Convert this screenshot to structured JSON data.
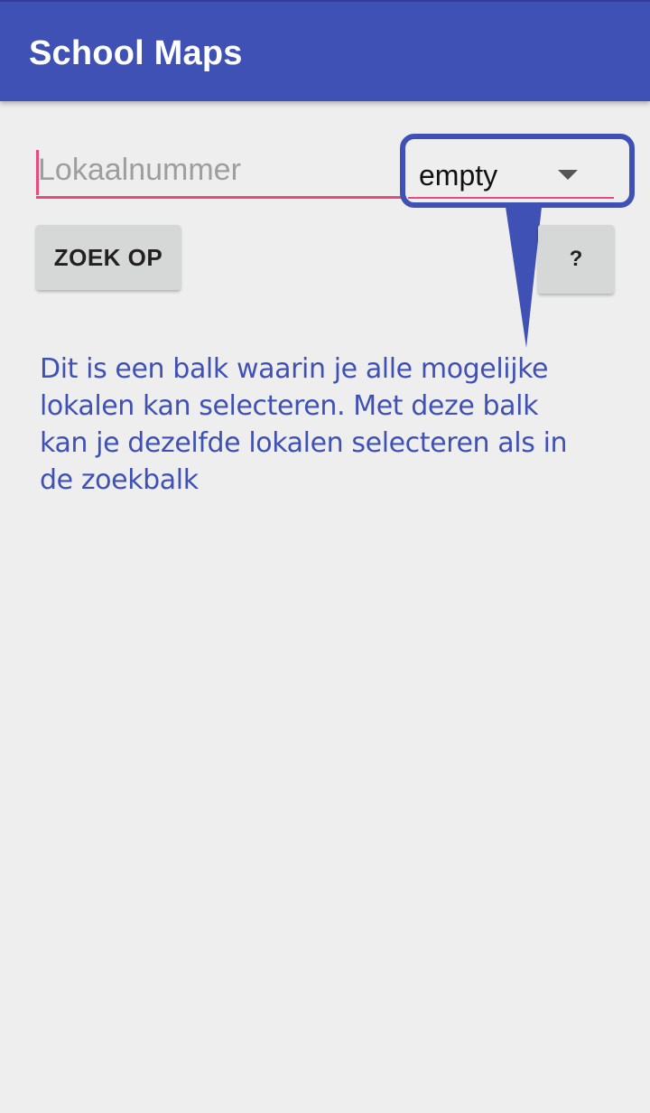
{
  "app_bar": {
    "title": "School Maps",
    "color": "#3f51b5"
  },
  "search": {
    "placeholder": "Lokaalnummer",
    "value": "",
    "accent_color": "#e84a80"
  },
  "spinner": {
    "selected": "empty",
    "icon": "dropdown-arrow-icon"
  },
  "buttons": {
    "search_label": "ZOEK OP",
    "help_label": "?"
  },
  "tooltip": {
    "text": "Dit is een balk waarin je alle mogelijke lokalen kan selecteren. Met deze balk kan je dezelfde lokalen selecteren als in de zoekbalk",
    "color": "#3f51b5"
  }
}
